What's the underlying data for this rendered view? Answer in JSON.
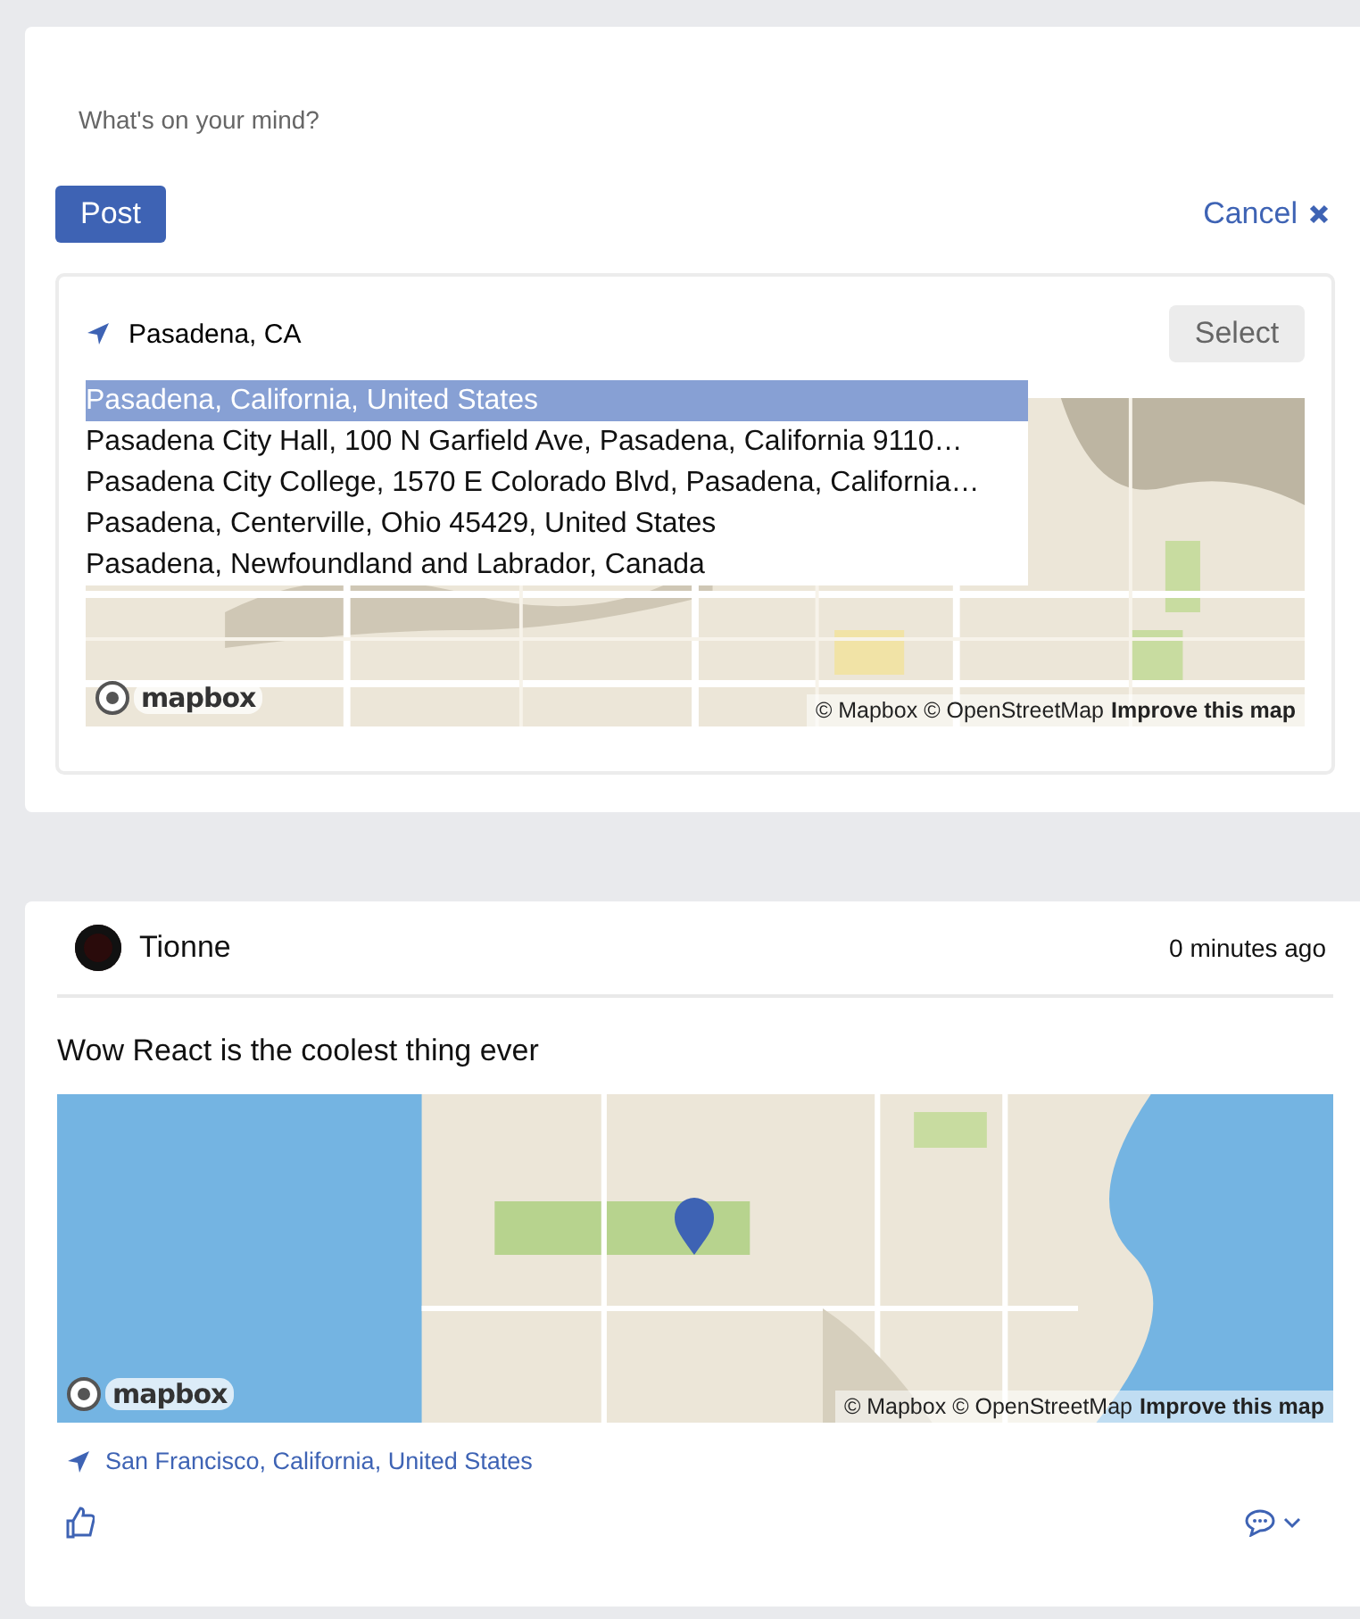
{
  "composer": {
    "placeholder": "What's on your mind?",
    "post_button": "Post",
    "cancel_link": "Cancel",
    "location": {
      "value": "Pasadena, CA",
      "select_button": "Select",
      "suggestions": [
        {
          "text": "Pasadena, California, United States",
          "selected": true
        },
        {
          "text": "Pasadena City Hall, 100 N Garfield Ave, Pasadena, California 9110…",
          "selected": false
        },
        {
          "text": "Pasadena City College, 1570 E Colorado Blvd, Pasadena, California…",
          "selected": false
        },
        {
          "text": "Pasadena, Centerville, Ohio 45429, United States",
          "selected": false
        },
        {
          "text": "Pasadena, Newfoundland and Labrador, Canada",
          "selected": false
        }
      ],
      "map": {
        "kind": "land",
        "logo": "mapbox",
        "attribution": "© Mapbox © OpenStreetMap",
        "improve_link": "Improve this map"
      }
    }
  },
  "posts": [
    {
      "author": "Tionne",
      "time": "0 minutes ago",
      "text": "Wow React is the coolest thing ever",
      "map": {
        "kind": "coast",
        "logo": "mapbox",
        "attribution": "© Mapbox © OpenStreetMap",
        "improve_link": "Improve this map"
      },
      "location": "San Francisco, California, United States"
    }
  ]
}
